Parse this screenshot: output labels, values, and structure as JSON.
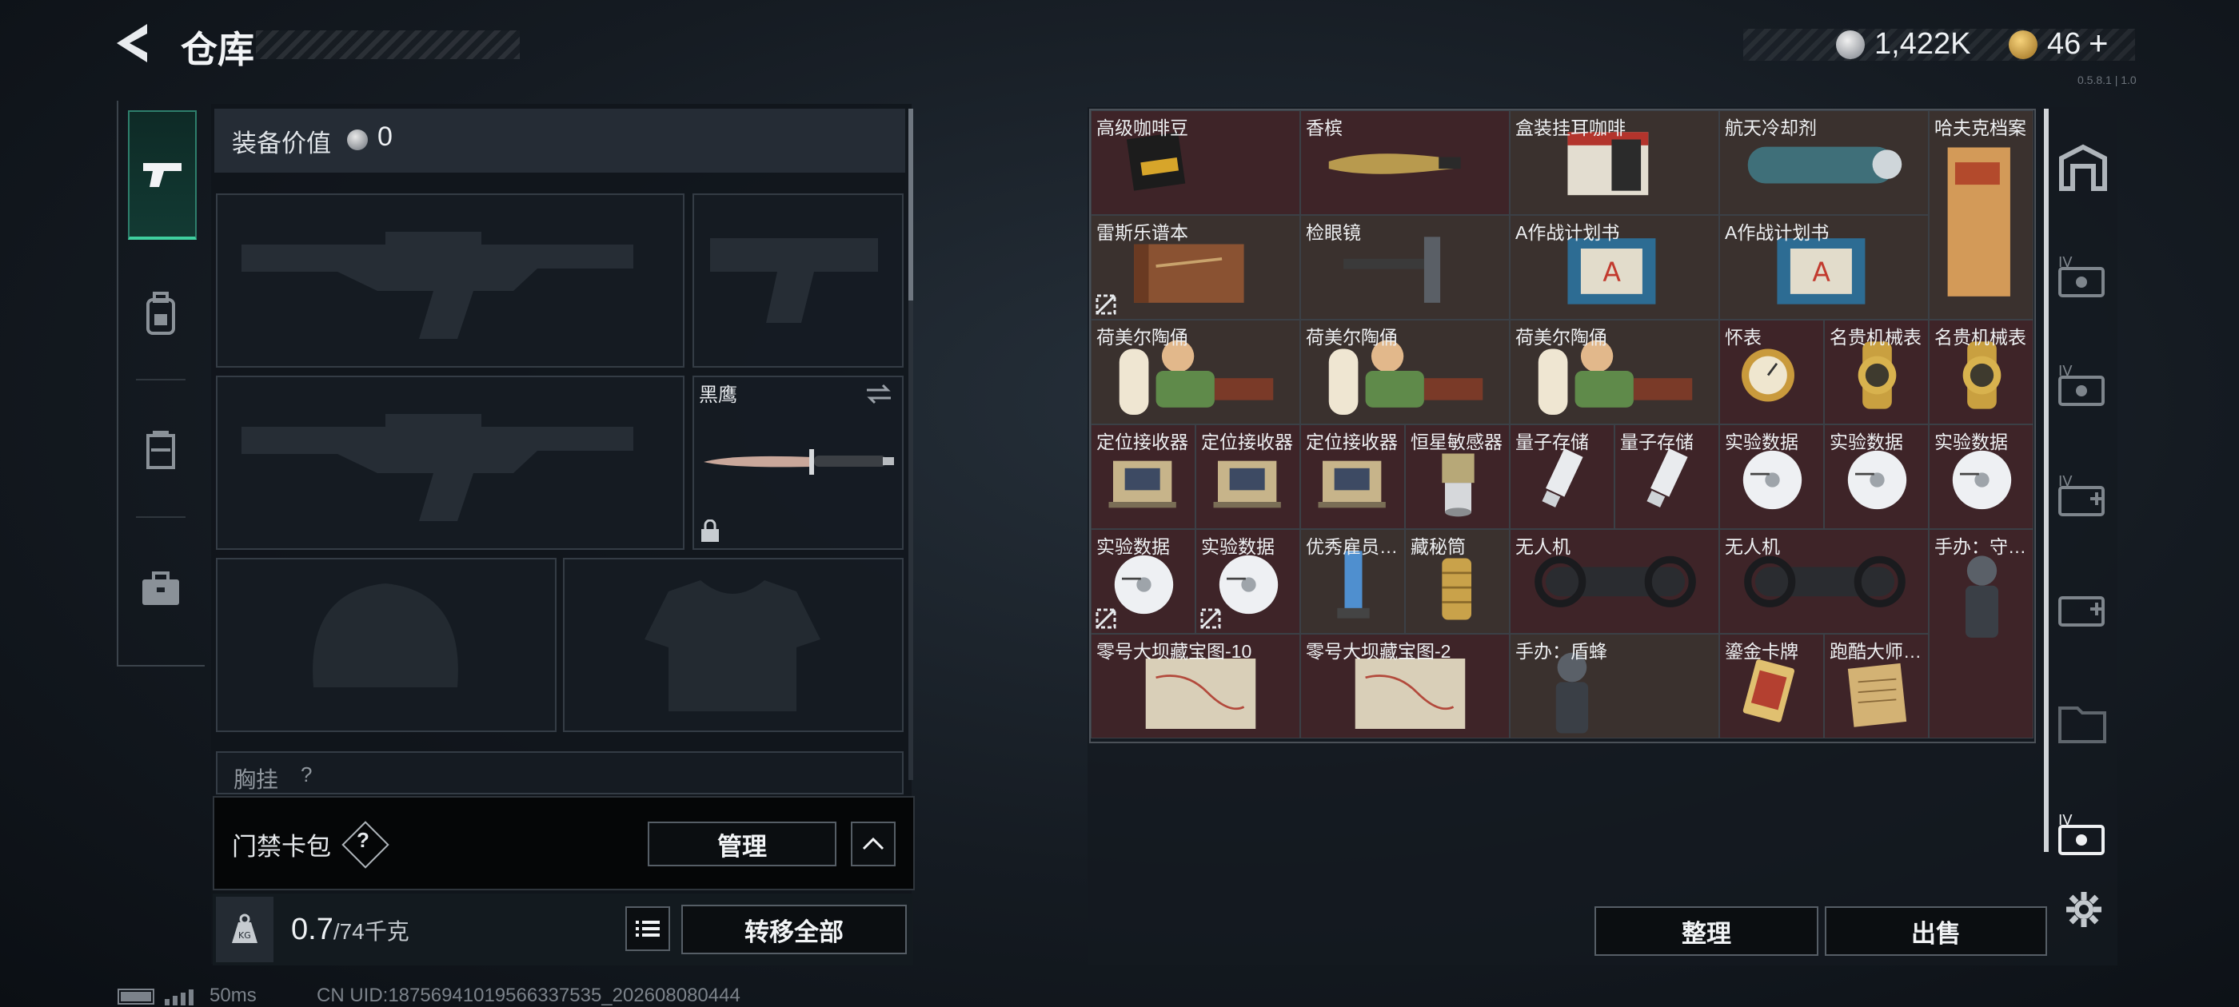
{
  "header": {
    "title": "仓库",
    "currency_silver": "1,422K",
    "currency_gold": "46",
    "gold_plus": "+",
    "version": "0.5.8.1 | 1.0"
  },
  "equipment": {
    "value_label": "装备价值",
    "value": "0",
    "melee_name": "黑鹰",
    "chest_rig_label": "胸挂",
    "chest_rig_hint": "?"
  },
  "access_card": {
    "label": "门禁卡包",
    "help": "?",
    "manage_label": "管理"
  },
  "weight": {
    "current": "0.7",
    "max": "/74千克",
    "transfer_all_label": "转移全部"
  },
  "storage": {
    "items": [
      {
        "label": "高级咖啡豆",
        "icon": "coffee-bag-icon"
      },
      {
        "label": "香槟",
        "icon": "champagne-icon"
      },
      {
        "label": "盒装挂耳咖啡",
        "icon": "coffee-box-icon"
      },
      {
        "label": "航天冷却剂",
        "icon": "coolant-tank-icon"
      },
      {
        "label": "哈夫克档案",
        "icon": "dossier-icon"
      },
      {
        "label": "雷斯乐谱本",
        "icon": "music-book-icon"
      },
      {
        "label": "检眼镜",
        "icon": "ophthalmoscope-icon"
      },
      {
        "label": "A作战计划书",
        "icon": "plan-book-icon"
      },
      {
        "label": "A作战计划书",
        "icon": "plan-book-icon"
      },
      {
        "label": "荷美尔陶俑",
        "icon": "figurine-icon"
      },
      {
        "label": "荷美尔陶俑",
        "icon": "figurine-icon"
      },
      {
        "label": "荷美尔陶俑",
        "icon": "figurine-icon"
      },
      {
        "label": "怀表",
        "icon": "pocket-watch-icon"
      },
      {
        "label": "名贵机械表",
        "icon": "gold-watch-icon"
      },
      {
        "label": "名贵机械表",
        "icon": "gold-watch-icon"
      },
      {
        "label": "定位接收器",
        "icon": "receiver-icon"
      },
      {
        "label": "定位接收器",
        "icon": "receiver-icon"
      },
      {
        "label": "定位接收器",
        "icon": "receiver-icon"
      },
      {
        "label": "恒星敏感器",
        "icon": "star-sensor-icon"
      },
      {
        "label": "量子存储",
        "icon": "usb-drive-icon"
      },
      {
        "label": "量子存储",
        "icon": "usb-drive-icon"
      },
      {
        "label": "实验数据",
        "icon": "disc-icon"
      },
      {
        "label": "实验数据",
        "icon": "disc-icon"
      },
      {
        "label": "实验数据",
        "icon": "disc-icon"
      },
      {
        "label": "实验数据",
        "icon": "disc-icon"
      },
      {
        "label": "实验数据",
        "icon": "disc-icon"
      },
      {
        "label": "优秀雇员…",
        "icon": "trophy-icon"
      },
      {
        "label": "藏秘筒",
        "icon": "cryptex-icon"
      },
      {
        "label": "无人机",
        "icon": "drone-icon"
      },
      {
        "label": "无人机",
        "icon": "drone-icon"
      },
      {
        "label": "手办：守…",
        "icon": "action-figure-icon"
      },
      {
        "label": "零号大坝藏宝图-10",
        "icon": "treasure-map-icon"
      },
      {
        "label": "零号大坝藏宝图-2",
        "icon": "treasure-map-icon"
      },
      {
        "label": "手办：盾蜂",
        "icon": "action-figure-icon"
      },
      {
        "label": "鎏金卡牌",
        "icon": "gold-card-icon"
      },
      {
        "label": "跑酷大师…",
        "icon": "scroll-paper-icon"
      }
    ],
    "sort_label": "整理",
    "sell_label": "出售"
  },
  "status": {
    "ping": "50ms",
    "uid": "CN UID:18756941019566337535_202608080444"
  },
  "colors": {
    "accent_green": "#3fcf9f",
    "red_cell": "#3e2428",
    "brown_cell": "#3a312e"
  }
}
